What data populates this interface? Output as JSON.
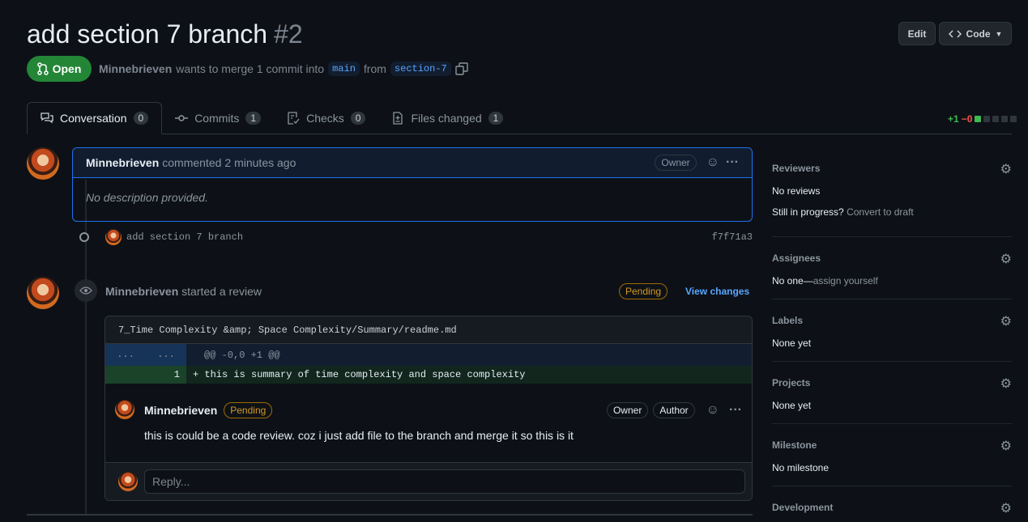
{
  "pr": {
    "title": "add section 7 branch",
    "number": "#2",
    "state": "Open",
    "author": "Minnebrieven",
    "merge_text": "wants to merge 1 commit into",
    "base_branch": "main",
    "from_text": "from",
    "head_branch": "section-7"
  },
  "header_buttons": {
    "edit": "Edit",
    "code": "Code"
  },
  "tabs": [
    {
      "label": "Conversation",
      "count": "0"
    },
    {
      "label": "Commits",
      "count": "1"
    },
    {
      "label": "Checks",
      "count": "0"
    },
    {
      "label": "Files changed",
      "count": "1"
    }
  ],
  "diffstat": {
    "additions": "+1",
    "deletions": "−0"
  },
  "comment": {
    "author": "Minnebrieven",
    "action": "commented",
    "time": "2 minutes ago",
    "role": "Owner",
    "body": "No description provided."
  },
  "commit": {
    "message": "add section 7 branch",
    "sha": "f7f71a3"
  },
  "review": {
    "author": "Minnebrieven",
    "action": "started a review",
    "status": "Pending",
    "view_changes": "View changes",
    "file_path": "7_Time Complexity &amp; Space Complexity/Summary/readme.md",
    "hunk_ln_old": "...",
    "hunk_ln_new": "...",
    "hunk_header": "@@ -0,0 +1 @@",
    "added_ln": "1",
    "added_line": "+ this is summary of time complexity and space complexity",
    "inline_comment": {
      "author": "Minnebrieven",
      "status": "Pending",
      "owner": "Owner",
      "author_badge": "Author",
      "body": "this is could be a code review. coz i just add file to the branch and merge it so this is it"
    },
    "reply_placeholder": "Reply..."
  },
  "sidebar": {
    "reviewers": {
      "title": "Reviewers",
      "value": "No reviews",
      "draft_q": "Still in progress?",
      "draft_link": "Convert to draft"
    },
    "assignees": {
      "title": "Assignees",
      "value": "No one—",
      "link": "assign yourself"
    },
    "labels": {
      "title": "Labels",
      "value": "None yet"
    },
    "projects": {
      "title": "Projects",
      "value": "None yet"
    },
    "milestone": {
      "title": "Milestone",
      "value": "No milestone"
    },
    "development": {
      "title": "Development"
    }
  },
  "colors": {
    "accent": "#58a6ff",
    "open_green": "#238636",
    "pending": "#d29922",
    "border_blue": "#1f6feb"
  }
}
